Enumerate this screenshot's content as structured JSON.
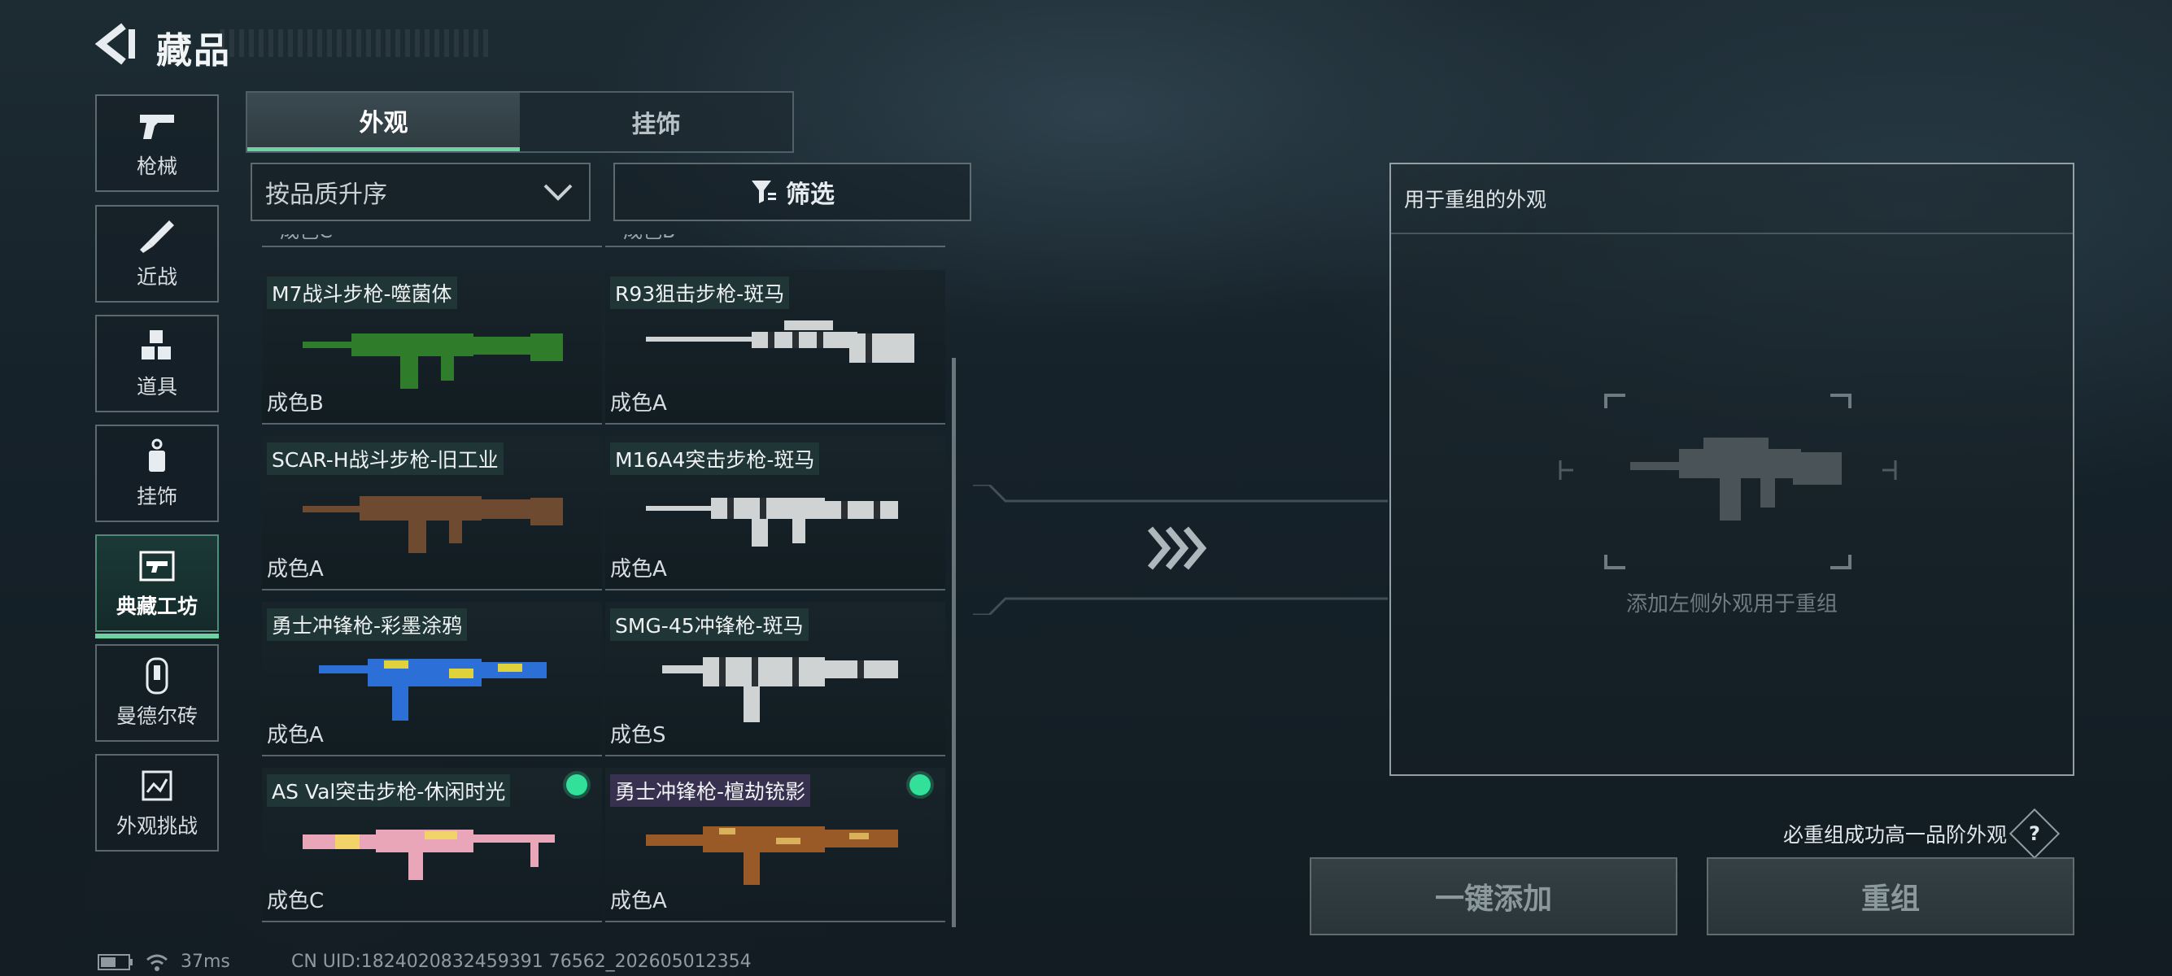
{
  "header": {
    "title": "藏品"
  },
  "nav": {
    "items": [
      {
        "label": "枪械",
        "icon": "pistol-icon"
      },
      {
        "label": "近战",
        "icon": "knife-icon"
      },
      {
        "label": "道具",
        "icon": "grenade-cubes-icon"
      },
      {
        "label": "挂饰",
        "icon": "charm-icon"
      },
      {
        "label": "典藏工坊",
        "icon": "workshop-gun-icon",
        "active": true
      },
      {
        "label": "曼德尔砖",
        "icon": "mandel-brick-icon"
      },
      {
        "label": "外观挑战",
        "icon": "challenge-map-icon"
      }
    ]
  },
  "tabs": [
    {
      "label": "外观",
      "active": true
    },
    {
      "label": "挂饰",
      "active": false
    }
  ],
  "sort": {
    "label": "按品质升序"
  },
  "filter": {
    "label": "筛选"
  },
  "partial_row": [
    "成色C",
    "成色B"
  ],
  "items": [
    {
      "name": "M7战斗步枪-噬菌体",
      "grade": "成色B",
      "name_style": "green",
      "equipped": false,
      "gun_color": "#2f7d2a"
    },
    {
      "name": "R93狙击步枪-斑马",
      "grade": "成色A",
      "name_style": "green",
      "equipped": false,
      "gun_color": "#cfd3d4"
    },
    {
      "name": "SCAR-H战斗步枪-旧工业",
      "grade": "成色A",
      "name_style": "green",
      "equipped": false,
      "gun_color": "#6e4a30"
    },
    {
      "name": "M16A4突击步枪-斑马",
      "grade": "成色A",
      "name_style": "green",
      "equipped": false,
      "gun_color": "#cfd3d4"
    },
    {
      "name": "勇士冲锋枪-彩墨涂鸦",
      "grade": "成色A",
      "name_style": "green",
      "equipped": false,
      "gun_color": "#2c6fd6"
    },
    {
      "name": "SMG-45冲锋枪-斑马",
      "grade": "成色S",
      "name_style": "green",
      "equipped": false,
      "gun_color": "#cfd3d4"
    },
    {
      "name": "AS Val突击步枪-休闲时光",
      "grade": "成色C",
      "name_style": "green",
      "equipped": true,
      "gun_color": "#e9a6b8"
    },
    {
      "name": "勇士冲锋枪-檀劫铳影",
      "grade": "成色A",
      "name_style": "purple",
      "equipped": true,
      "gun_color": "#9a5a28"
    }
  ],
  "panel": {
    "title": "用于重组的外观",
    "hint": "添加左侧外观用于重组"
  },
  "guarantee": {
    "text": "必重组成功高一品阶外观",
    "help": "?"
  },
  "buttons": {
    "add_all": "一键添加",
    "reform": "重组"
  },
  "status": {
    "ping": "37ms",
    "uid": "CN UID:1824020832459391 76562_202605012354"
  },
  "colors": {
    "accent": "#6fd0a2",
    "equipped_dot": "#33e09a"
  }
}
